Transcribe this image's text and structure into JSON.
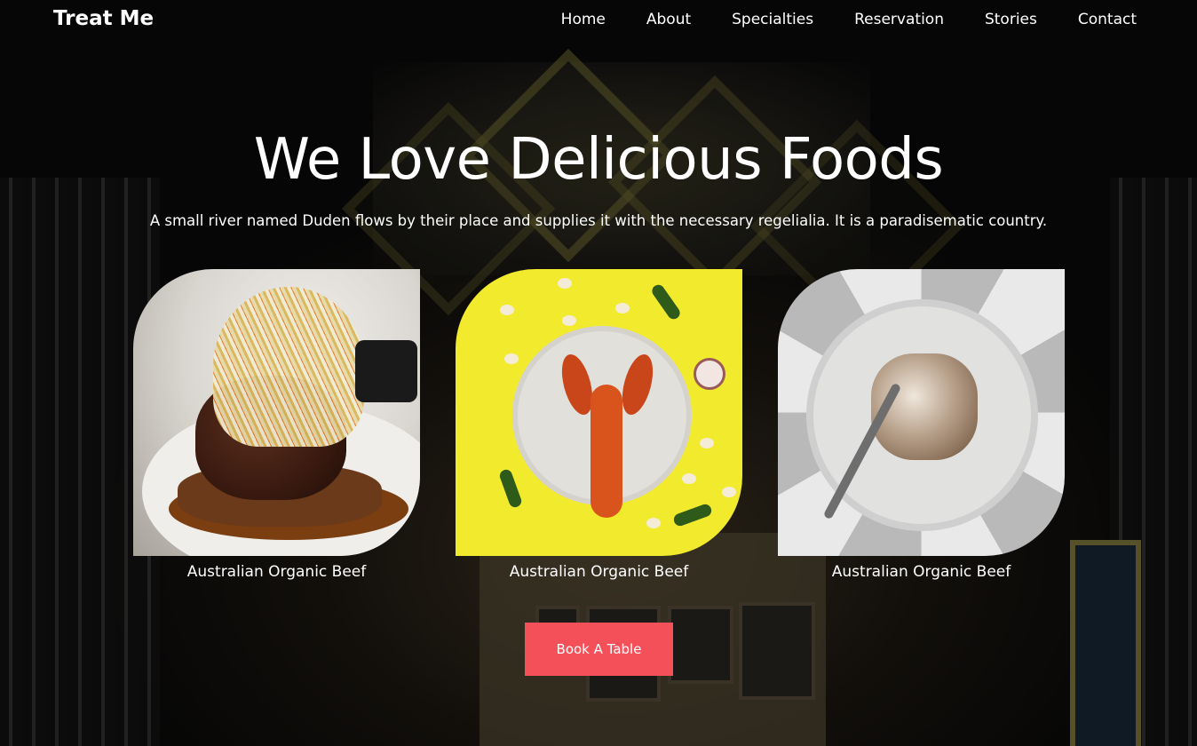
{
  "brand": "Treat Me",
  "nav": {
    "items": [
      {
        "label": "Home"
      },
      {
        "label": "About"
      },
      {
        "label": "Specialties"
      },
      {
        "label": "Reservation"
      },
      {
        "label": "Stories"
      },
      {
        "label": "Contact"
      }
    ]
  },
  "hero": {
    "title": "We Love Delicious Foods",
    "subtitle": "A small river named Duden flows by their place and supplies it with the necessary regelialia. It is a paradisematic country."
  },
  "dishes": [
    {
      "caption": "Australian Organic Beef"
    },
    {
      "caption": "Australian Organic Beef"
    },
    {
      "caption": "Australian Organic Beef"
    }
  ],
  "cta": {
    "label": "Book A Table"
  },
  "colors": {
    "accent": "#f3505a",
    "background": "#050505",
    "text": "#ffffff"
  }
}
